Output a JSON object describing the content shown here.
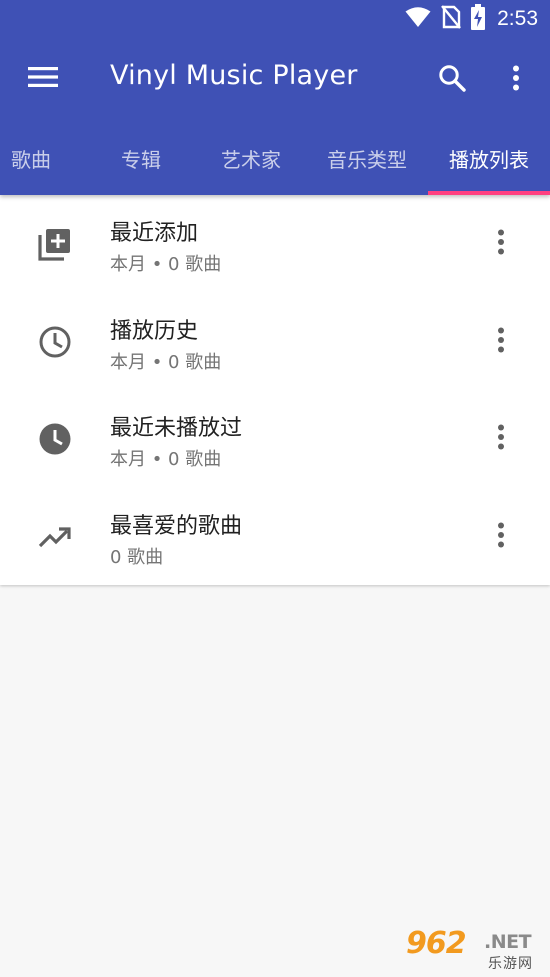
{
  "status_bar": {
    "time": "2:53",
    "icons": [
      "wifi-icon",
      "no-sim-icon",
      "battery-charging-icon"
    ]
  },
  "toolbar": {
    "title": "Vinyl Music Player",
    "menu_icon": "hamburger-menu-icon",
    "search_icon": "search-icon",
    "overflow_icon": "more-vertical-icon"
  },
  "tabs": [
    {
      "label": "歌曲",
      "active": false
    },
    {
      "label": "专辑",
      "active": false
    },
    {
      "label": "艺术家",
      "active": false
    },
    {
      "label": "音乐类型",
      "active": false
    },
    {
      "label": "播放列表",
      "active": true
    }
  ],
  "colors": {
    "primary": "#3f51b5",
    "accent": "#ff4081",
    "icon": "#616161"
  },
  "playlists": [
    {
      "title": "最近添加",
      "subtitle": "本月 • 0 歌曲",
      "icon": "library-add-icon"
    },
    {
      "title": "播放历史",
      "subtitle": "本月 • 0 歌曲",
      "icon": "clock-outline-icon"
    },
    {
      "title": "最近未播放过",
      "subtitle": "本月 • 0 歌曲",
      "icon": "clock-filled-icon"
    },
    {
      "title": "最喜爱的歌曲",
      "subtitle": "0 歌曲",
      "icon": "trending-up-icon"
    }
  ],
  "watermark": {
    "logo": "962",
    "net": ".NET",
    "cn": "乐游网"
  }
}
